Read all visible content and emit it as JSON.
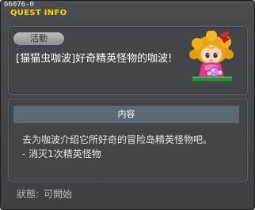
{
  "window": {
    "id_code": "66076-0",
    "title": "QUEST INFO"
  },
  "quest": {
    "category_badge": "活動",
    "name": "[猫猫虫咖波]好奇精英怪物的咖波!",
    "portrait_icon": "npc-girl-icon"
  },
  "content": {
    "header": "内容",
    "lines": [
      "去为咖波介绍它所好奇的冒险岛精英怪物吧。",
      "- 消灭1次精英怪物"
    ]
  },
  "status": {
    "label": "狀態:",
    "value": "可開始"
  },
  "colors": {
    "title": "#ffd700",
    "panel": "#434549",
    "content_header": "#5b6a73"
  }
}
